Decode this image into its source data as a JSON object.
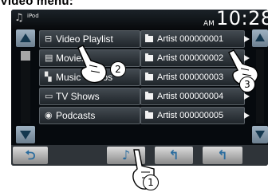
{
  "heading": "Video menu:",
  "status": {
    "source": "iPod",
    "ampm": "AM",
    "time": "10:28"
  },
  "categories": [
    {
      "label": "Video Playlist",
      "icon": "⊟",
      "icon_name": "playlist-icon"
    },
    {
      "label": "Movies",
      "icon": "▤",
      "icon_name": "movies-icon"
    },
    {
      "label": "Music Videos",
      "icon": "▚",
      "icon_name": "music-video-icon"
    },
    {
      "label": "TV Shows",
      "icon": "▭",
      "icon_name": "tv-icon"
    },
    {
      "label": "Podcasts",
      "icon": "◉",
      "icon_name": "podcast-icon"
    }
  ],
  "artists": [
    "Artist 000000001",
    "Artist 000000002",
    "Artist 000000003",
    "Artist 000000004",
    "Artist 000000005"
  ],
  "bottom_buttons": {
    "back": "⮌",
    "music": "♪",
    "up1": "↰",
    "up2": "↰"
  },
  "callouts": [
    "1",
    "2",
    "3"
  ],
  "colors": {
    "screen": "#060a0e",
    "button_blue": "#2a6c9e",
    "scroll": "#8fa3b3"
  }
}
